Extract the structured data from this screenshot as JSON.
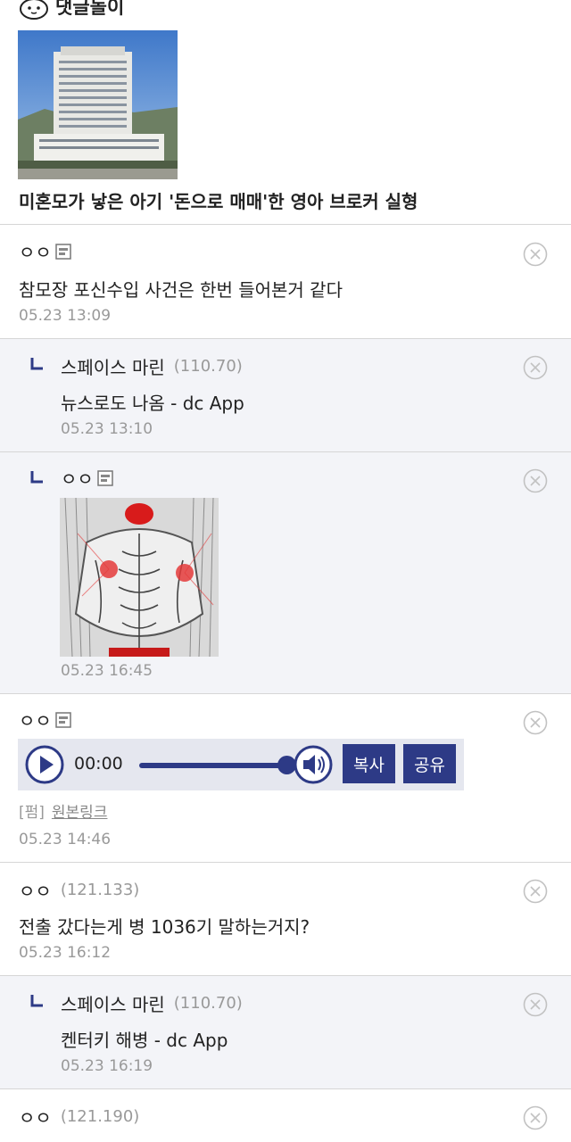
{
  "top": {
    "title": "댓글돌이",
    "headline": "미혼모가 낳은 아기 '돈으로 매매'한 영아 브로커 실형"
  },
  "comments": [
    {
      "author": "ㅇㅇ",
      "text": "참모장 포신수입 사건은 한번 들어본거 같다",
      "date": "05.23 13:09"
    },
    {
      "author": "스페이스 마린",
      "ip": "(110.70)",
      "text": "뉴스로도 나옴 - dc App",
      "date": "05.23 13:10"
    },
    {
      "author": "ㅇㅇ",
      "date": "05.23 16:45"
    },
    {
      "author": "ㅇㅇ",
      "date": "05.23 14:46"
    },
    {
      "author": "ㅇㅇ",
      "ip": "(121.133)",
      "text": "전출 갔다는게 병 1036기 말하는거지?",
      "date": "05.23 16:12"
    },
    {
      "author": "스페이스 마린",
      "ip": "(110.70)",
      "text": "켄터키 해병 - dc App",
      "date": "05.23 16:19"
    },
    {
      "author": "ㅇㅇ",
      "ip": "(121.190)"
    }
  ],
  "audio": {
    "time": "00:00",
    "copy_label": "복사",
    "share_label": "공유",
    "source_tag": "[펌]",
    "source_link": "원본링크"
  },
  "colors": {
    "accent": "#2d3a86",
    "reply_bg": "#f3f4f8",
    "muted": "#999999"
  }
}
